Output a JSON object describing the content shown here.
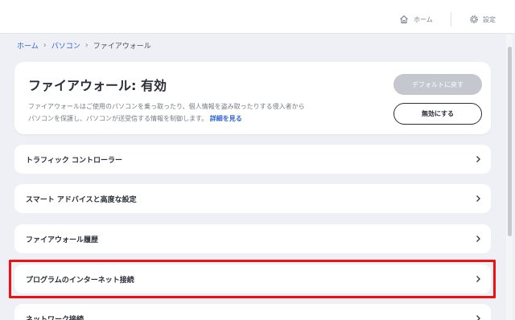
{
  "topbar": {
    "home_label": "ホーム",
    "settings_label": "設定"
  },
  "breadcrumb": {
    "items": [
      "ホーム",
      "パソコン"
    ],
    "current": "ファイアウォール",
    "separator": "›"
  },
  "status_card": {
    "title": "ファイアウォール: 有効",
    "description_line1": "ファイアウォールはご使用のパソコンを乗っ取ったり、個人情報を盗み取ったりする侵入者から",
    "description_line2": "パソコンを保護し、パソコンが送受信する情報を制御します。",
    "details_link": "詳細を見る",
    "default_button_label": "デフォルトに戻す",
    "disable_button_label": "無効にする"
  },
  "list_items": [
    {
      "label": "トラフィック コントローラー"
    },
    {
      "label": "スマート アドバイスと高度な設定"
    },
    {
      "label": "ファイアウォール履歴"
    },
    {
      "label": "プログラムのインターネット接続"
    },
    {
      "label": "ネットワーク接続"
    }
  ],
  "colors": {
    "accent_link": "#2e63d9",
    "highlight": "#ee1111",
    "disabled_button": "#c4c7ce",
    "background": "#eef0f5"
  }
}
